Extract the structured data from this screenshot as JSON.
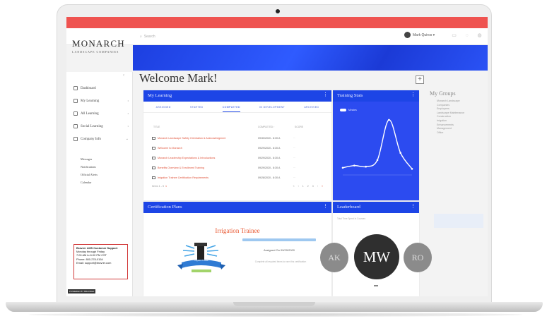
{
  "brand": {
    "name": "MONARCH",
    "tagline": "LANDSCAPE COMPANIES"
  },
  "search": {
    "placeholder": "Search"
  },
  "user": {
    "name": "Mark Quiros ▾"
  },
  "sidebar": {
    "items": [
      {
        "label": "Dashboard",
        "icon": "home-icon",
        "chevron": ""
      },
      {
        "label": "My Learning",
        "icon": "book-icon",
        "chevron": "›"
      },
      {
        "label": "All Learning",
        "icon": "folder-icon",
        "chevron": "›"
      },
      {
        "label": "Social Learning",
        "icon": "chat-icon",
        "chevron": "›"
      },
      {
        "label": "Company Info",
        "icon": "info-icon",
        "chevron": "⌄"
      }
    ],
    "subitems": [
      "Messages",
      "Notifications",
      "Official Alerts",
      "Calendar"
    ],
    "support": {
      "title": "Bravrer LMS Customer Support",
      "hours": "Monday through Friday",
      "time": "7:00 AM to 6:00 PM CST",
      "phone_label": "Phone:",
      "phone": "800-278-0154",
      "email_label": "Email:",
      "email": "support@bravrer.com"
    },
    "powered": "POWERED BY BRAVRER"
  },
  "welcome": "Welcome Mark!",
  "my_learning": {
    "title": "My Learning",
    "tabs": [
      "ASSIGNED",
      "STARTED",
      "COMPLETED",
      "IN DEVELOPMENT",
      "ARCHIVED"
    ],
    "active_tab": 2,
    "columns": {
      "title": "TITLE",
      "completed": "COMPLETED ↑",
      "score": "SCORE"
    },
    "rows": [
      {
        "title": "Monarch Landscape Safety Orientation & Acknowledgment",
        "date": "09/30/2020 - 8:30 A"
      },
      {
        "title": "Welcome to Monarch",
        "date": "09/29/2020 - 8:30 A"
      },
      {
        "title": "Monarch Leadership Expectations & Introductions",
        "date": "09/29/2020 - 8:30 A"
      },
      {
        "title": "Benefits Overview & Enrollment Training",
        "date": "09/29/2020 - 8:30 A"
      },
      {
        "title": "Irrigation Trainee Certification Requirements",
        "date": "09/28/2020 - 8:30 A"
      }
    ],
    "pager": {
      "label": "Items 1 - 5",
      "current": "1",
      "pages": [
        "«",
        "‹",
        "1",
        "2",
        "3",
        "›",
        "»"
      ]
    }
  },
  "training_stats": {
    "title": "Training Stats",
    "legend": "Minutes"
  },
  "chart_data": {
    "type": "line",
    "title": "Training Stats",
    "series": [
      {
        "name": "Minutes",
        "values": [
          8,
          12,
          10,
          22,
          95,
          35,
          6
        ]
      }
    ],
    "x": [
      1,
      2,
      3,
      4,
      5,
      6,
      7
    ],
    "ylim": [
      0,
      100
    ],
    "grid": false,
    "legend": "top-left"
  },
  "certification": {
    "title": "Certification Plans",
    "plan_name": "Irrigation Trainee",
    "badge_label": "Irrigation Trainee",
    "assigned": "Assigned On 09/29/2020",
    "due": "Complete all required items to earn this certification",
    "progress": 0
  },
  "leaderboard": {
    "title": "Leaderboard",
    "subtitle": "Total Time Spent In Courses",
    "left": "AK",
    "center": "MW",
    "right": "RO"
  },
  "groups": {
    "title": "My Groups",
    "items": [
      "Monarch Landscape",
      "Companies",
      "Employees",
      "Landscape Maintenance",
      "Construction",
      "Irrigation",
      "Enhancements",
      "Management",
      "Office"
    ]
  }
}
